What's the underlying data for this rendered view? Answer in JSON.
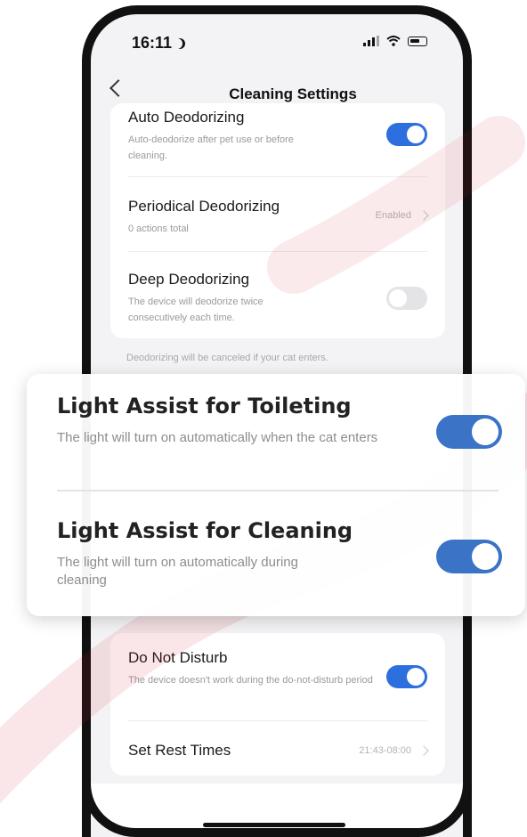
{
  "status_bar": {
    "time": "16:11"
  },
  "nav": {
    "title": "Cleaning Settings"
  },
  "top_card": {
    "rows": [
      {
        "title": "Auto Deodorizing",
        "desc": "Auto-deodorize after pet use or before cleaning.",
        "toggle": "on"
      },
      {
        "title": "Periodical Deodorizing",
        "desc": "0 actions total",
        "value": "Enabled"
      },
      {
        "title": "Deep Deodorizing",
        "desc": "The device will deodorize twice consecutively each time.",
        "toggle": "off"
      }
    ],
    "footnote": "Deodorizing will be canceled if your cat enters."
  },
  "overlay": {
    "items": [
      {
        "title": "Light Assist for Toileting",
        "desc": "The light will turn on automatically when the cat enters",
        "toggle": "on"
      },
      {
        "title": "Light Assist for Cleaning",
        "desc": "The light will turn on automatically during cleaning",
        "toggle": "on"
      }
    ]
  },
  "bottom_card": {
    "rows": [
      {
        "title": "Do Not Disturb",
        "desc": "The device doesn't work during the do-not-disturb period",
        "toggle": "on"
      },
      {
        "title": "Set Rest Times",
        "value": "21:43-08:00"
      }
    ]
  },
  "colors": {
    "toggle_on": "#2e6fe0",
    "overlay_toggle_on": "#3b73c7",
    "toggle_off": "#e4e4e6",
    "watermark": "#d92030"
  },
  "icons": [
    "moon-icon",
    "signal-icon",
    "wifi-icon",
    "battery-icon",
    "back-icon",
    "chevron-right-icon"
  ]
}
